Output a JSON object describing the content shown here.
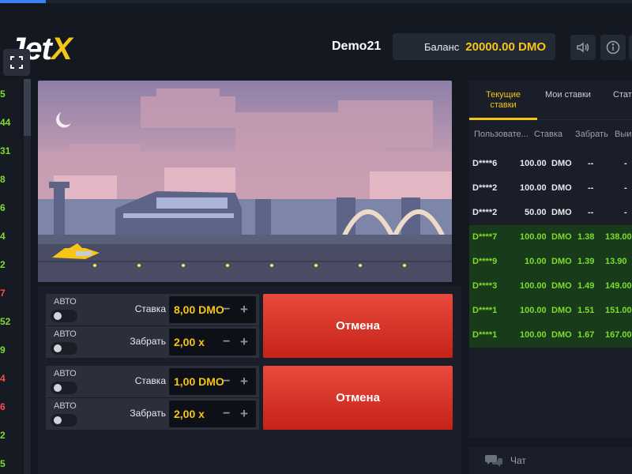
{
  "brand": {
    "logo_main": "Jet",
    "logo_accent": "X"
  },
  "header": {
    "username": "Demo21",
    "balance_label": "Баланс",
    "balance_value": "20000.00 DMO"
  },
  "left_history": [
    {
      "value": "5",
      "color": "#7fdc2c"
    },
    {
      "value": "44",
      "color": "#7fdc2c"
    },
    {
      "value": "31",
      "color": "#7fdc2c"
    },
    {
      "value": "8",
      "color": "#7fdc2c"
    },
    {
      "value": "6",
      "color": "#7fdc2c"
    },
    {
      "value": "4",
      "color": "#7fdc2c"
    },
    {
      "value": "2",
      "color": "#7fdc2c"
    },
    {
      "value": "7",
      "color": "#ff4d4d"
    },
    {
      "value": "52",
      "color": "#7fdc2c"
    },
    {
      "value": "9",
      "color": "#7fdc2c"
    },
    {
      "value": "4",
      "color": "#ff4d4d"
    },
    {
      "value": "6",
      "color": "#ff4d4d"
    },
    {
      "value": "2",
      "color": "#7fdc2c"
    },
    {
      "value": "5",
      "color": "#7fdc2c"
    }
  ],
  "bet_panels": [
    {
      "auto_1": "АВТО",
      "bet_label": "Ставка",
      "bet_value": "8,00 DMO",
      "auto_2": "АВТО",
      "cashout_label": "Забрать",
      "cashout_value": "2,00 x",
      "cancel_label": "Отмена"
    },
    {
      "auto_1": "АВТО",
      "bet_label": "Ставка",
      "bet_value": "1,00 DMO",
      "auto_2": "АВТО",
      "cashout_label": "Забрать",
      "cashout_value": "2,00 x",
      "cancel_label": "Отмена"
    }
  ],
  "right_panel": {
    "tabs": [
      {
        "label": "Текущие\nставки"
      },
      {
        "label": "Мои ставки"
      },
      {
        "label": "Стати"
      }
    ],
    "columns": [
      "Пользовате...",
      "Ставка",
      "Забрать",
      "Выи"
    ],
    "rows": [
      {
        "user": "D****6",
        "amount": "100.00",
        "currency": "DMO",
        "cashout": "--",
        "win": "-"
      },
      {
        "user": "D****2",
        "amount": "100.00",
        "currency": "DMO",
        "cashout": "--",
        "win": "-"
      },
      {
        "user": "D****2",
        "amount": "50.00",
        "currency": "DMO",
        "cashout": "--",
        "win": "-"
      },
      {
        "user": "D****7",
        "amount": "100.00",
        "currency": "DMO",
        "cashout": "1.38",
        "win": "138.00"
      },
      {
        "user": "D****9",
        "amount": "10.00",
        "currency": "DMO",
        "cashout": "1.39",
        "win": "13.90"
      },
      {
        "user": "D****3",
        "amount": "100.00",
        "currency": "DMO",
        "cashout": "1.49",
        "win": "149.00"
      },
      {
        "user": "D****1",
        "amount": "100.00",
        "currency": "DMO",
        "cashout": "1.51",
        "win": "151.00"
      },
      {
        "user": "D****1",
        "amount": "100.00",
        "currency": "DMO",
        "cashout": "1.67",
        "win": "167.00"
      }
    ],
    "chat_label": "Чат"
  },
  "icons": {
    "fullscreen": "fullscreen-icon",
    "sound": "speaker-icon",
    "info": "info-icon",
    "chat": "chat-bubbles-icon"
  },
  "colors": {
    "accent": "#f5c518",
    "win_green": "#7fdc2c",
    "cancel_red": "#e0332b"
  }
}
